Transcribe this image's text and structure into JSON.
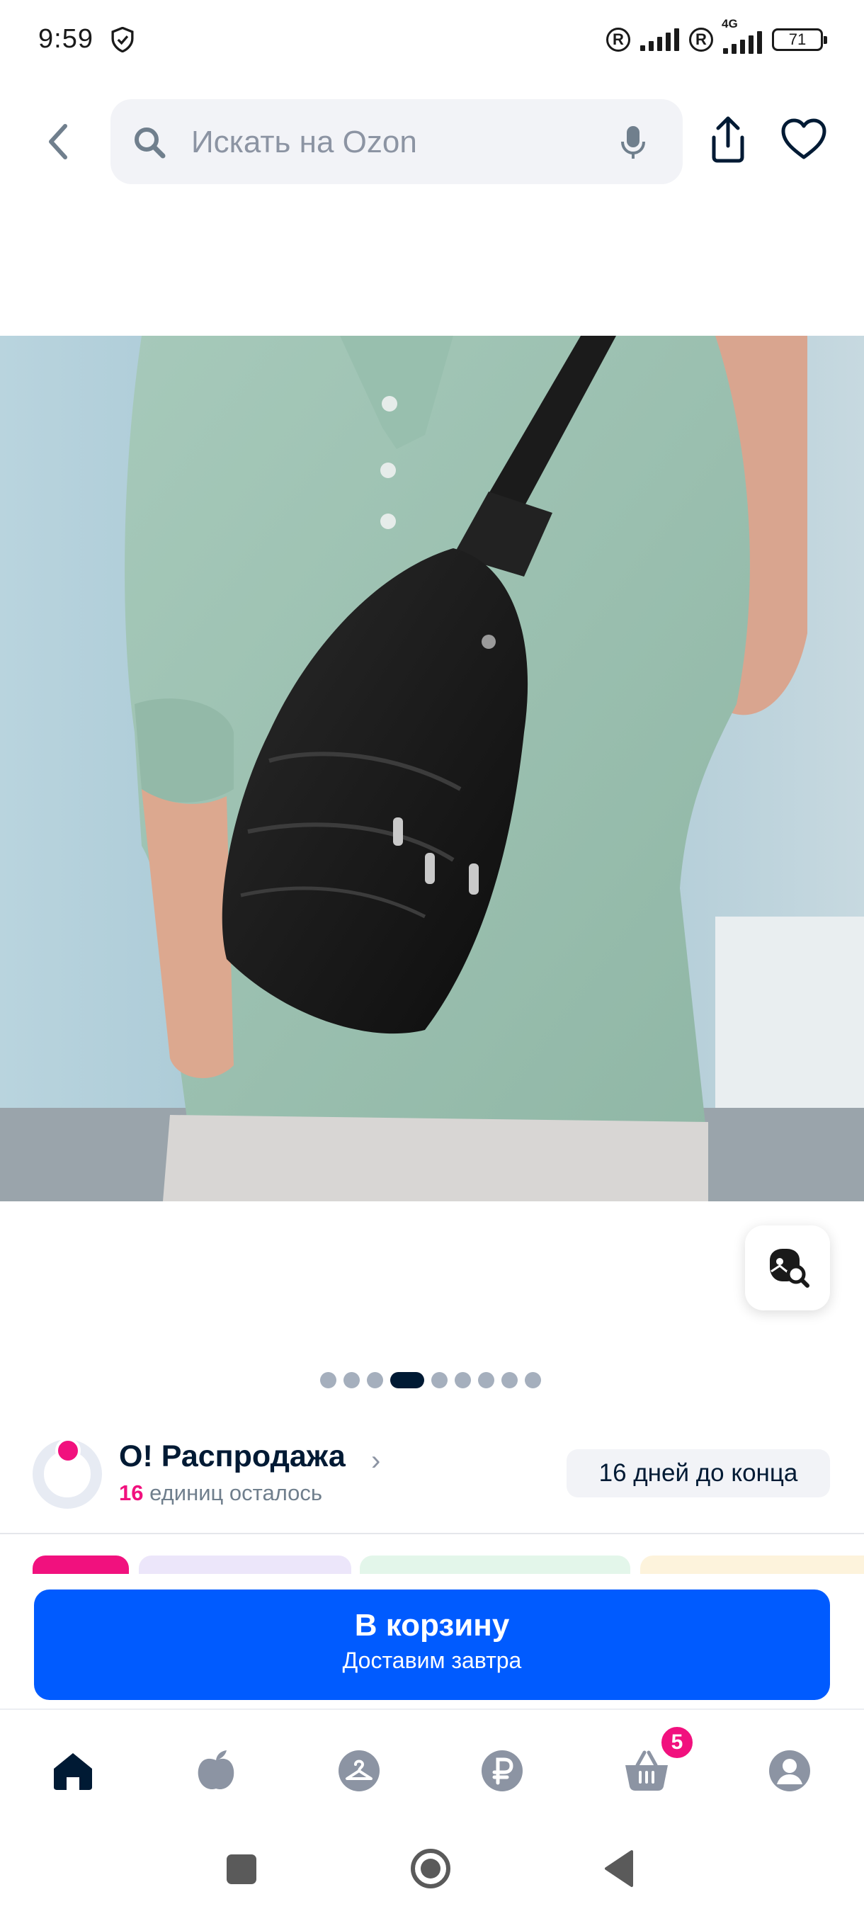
{
  "status_bar": {
    "time": "9:59",
    "network_label": "4G",
    "battery": "71",
    "roaming_symbol": "R"
  },
  "header": {
    "search_placeholder": "Искать на Ozon"
  },
  "gallery": {
    "image_count": 9,
    "active_index": 3
  },
  "sale": {
    "title": "О! Распродажа",
    "chevron": "›",
    "remaining_count": "16",
    "remaining_text": "единиц осталось",
    "days_left": "16 дней до конца"
  },
  "cart": {
    "button_label": "В корзину",
    "delivery_text": "Доставим завтра"
  },
  "bottom_nav": {
    "items": [
      "home-icon",
      "fresh-icon",
      "catalog-icon",
      "finance-icon",
      "cart-icon",
      "profile-icon"
    ],
    "cart_badge": "5"
  },
  "colors": {
    "accent": "#005bff",
    "sale_pink": "#f1117e",
    "text_dark": "#001a34",
    "muted": "#707f8d"
  }
}
